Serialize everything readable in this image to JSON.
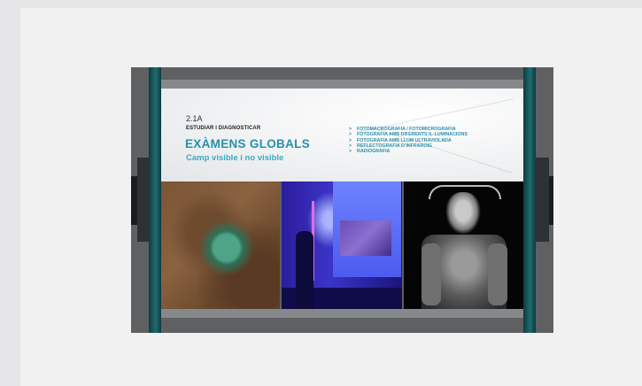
{
  "slide": {
    "code": "2.1A",
    "kicker": "ESTUDIAR I DIAGNOSTICAR",
    "title": "EXÀMENS GLOBALS",
    "subtitle": "Camp visible i no visible",
    "bullet_glyph": ">",
    "items": [
      "FOTOMACROGRAFIA / FOTOMICROGRAFIA",
      "FOTOGRAFIA AMB DIFERENTS IL·LUMINACIONS",
      "FOTOGRAFIA AMB LLUM ULTRAVIOLADA",
      "REFLECTOGRAFIA D’INFRAROIG",
      "RADIOGRAFIA"
    ]
  },
  "colors": {
    "accent": "#2a8fa8",
    "frame": "#5e6062",
    "post": "#1f6b70"
  }
}
